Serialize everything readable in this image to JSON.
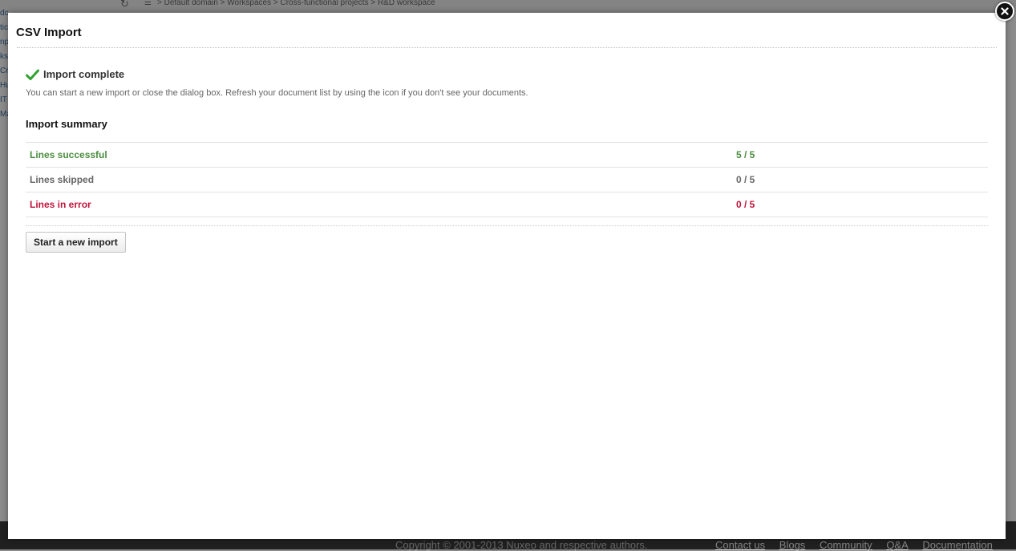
{
  "background": {
    "breadcrumb": "> Default domain > Workspaces > Cross-functional projects > R&D workspace",
    "left_links": [
      "domain",
      "tic",
      "np",
      "ks",
      "Cr",
      "Hu",
      "IT",
      "Ma"
    ],
    "footer": {
      "copyright": "Copyright © 2001-2013 Nuxeo and respective authors.",
      "links": [
        "Contact us",
        "Blogs",
        "Community",
        "Q&A",
        "Documentation"
      ]
    }
  },
  "dialog": {
    "title": "CSV Import",
    "status_icon": "check-icon",
    "status_title": "Import complete",
    "status_description": "You can start a new import or close the dialog box. Refresh your document list by using the icon if you don't see your documents.",
    "summary_title": "Import summary",
    "summary_rows": [
      {
        "label": "Lines successful",
        "value": "5 / 5",
        "color": "#4a8d3e"
      },
      {
        "label": "Lines skipped",
        "value": "0 / 5",
        "color": "#666666"
      },
      {
        "label": "Lines in error",
        "value": "0 / 5",
        "color": "#c0143c"
      }
    ],
    "new_import_label": "Start a new import",
    "close_icon": "close-icon"
  }
}
